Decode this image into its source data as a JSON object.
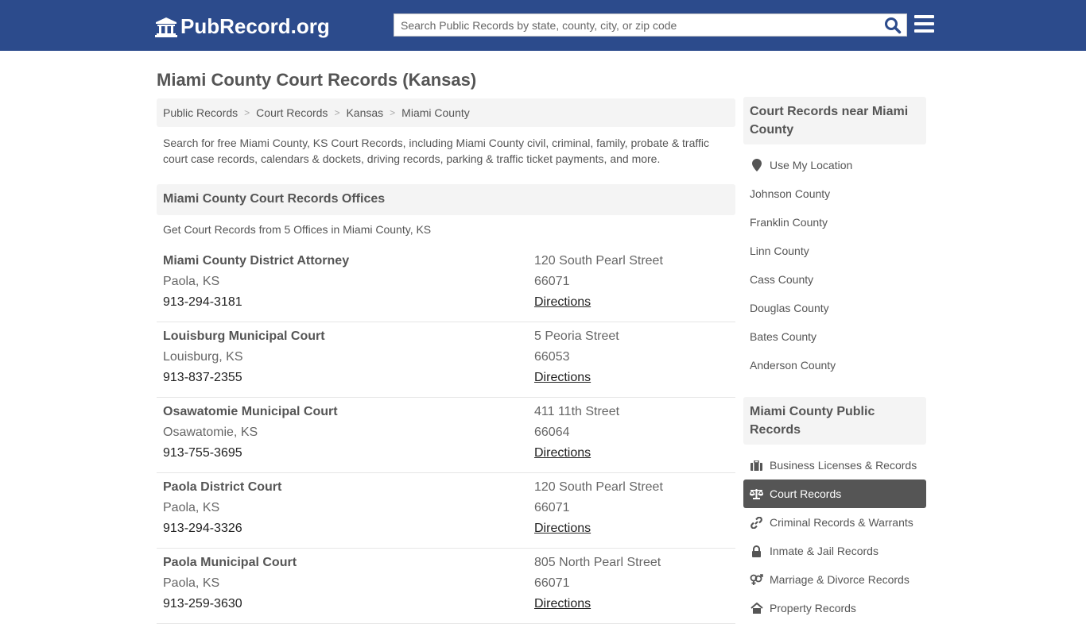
{
  "header": {
    "logo_text": "PubRecord.org",
    "search_placeholder": "Search Public Records by state, county, city, or zip code"
  },
  "page": {
    "title": "Miami County Court Records (Kansas)",
    "breadcrumb": [
      "Public Records",
      "Court Records",
      "Kansas",
      "Miami County"
    ],
    "breadcrumb_separator": ">",
    "intro": "Search for free Miami County, KS Court Records, including Miami County civil, criminal, family, probate & traffic court case records, calendars & dockets, driving records, parking & traffic ticket payments, and more."
  },
  "offices_section": {
    "heading": "Miami County Court Records Offices",
    "subheading": "Get Court Records from 5 Offices in Miami County, KS",
    "offices": [
      {
        "name": "Miami County District Attorney",
        "city": "Paola, KS",
        "phone": "913-294-3181",
        "address": "120 South Pearl Street",
        "zip": "66071",
        "link": "Directions"
      },
      {
        "name": "Louisburg Municipal Court",
        "city": "Louisburg, KS",
        "phone": "913-837-2355",
        "address": "5 Peoria Street",
        "zip": "66053",
        "link": "Directions"
      },
      {
        "name": "Osawatomie Municipal Court",
        "city": "Osawatomie, KS",
        "phone": "913-755-3695",
        "address": "411 11th Street",
        "zip": "66064",
        "link": "Directions"
      },
      {
        "name": "Paola District Court",
        "city": "Paola, KS",
        "phone": "913-294-3326",
        "address": "120 South Pearl Street",
        "zip": "66071",
        "link": "Directions"
      },
      {
        "name": "Paola Municipal Court",
        "city": "Paola, KS",
        "phone": "913-259-3630",
        "address": "805 North Pearl Street",
        "zip": "66071",
        "link": "Directions"
      }
    ]
  },
  "sidebar": {
    "nearby": {
      "heading": "Court Records near Miami County",
      "location_label": "Use My Location",
      "counties": [
        "Johnson County",
        "Franklin County",
        "Linn County",
        "Cass County",
        "Douglas County",
        "Bates County",
        "Anderson County"
      ]
    },
    "public_records": {
      "heading": "Miami County Public Records",
      "items": [
        {
          "label": "Business Licenses & Records",
          "icon": "briefcase-icon",
          "active": false
        },
        {
          "label": "Court Records",
          "icon": "scale-icon",
          "active": true
        },
        {
          "label": "Criminal Records & Warrants",
          "icon": "link-icon",
          "active": false
        },
        {
          "label": "Inmate & Jail Records",
          "icon": "lock-icon",
          "active": false
        },
        {
          "label": "Marriage & Divorce Records",
          "icon": "gender-icon",
          "active": false
        },
        {
          "label": "Property Records",
          "icon": "home-icon",
          "active": false
        }
      ]
    }
  },
  "colors": {
    "header_bg": "#2c4b8c",
    "panel_bg": "#f4f4f4",
    "active_bg": "#555555",
    "search_icon": "#2c4b8c"
  }
}
